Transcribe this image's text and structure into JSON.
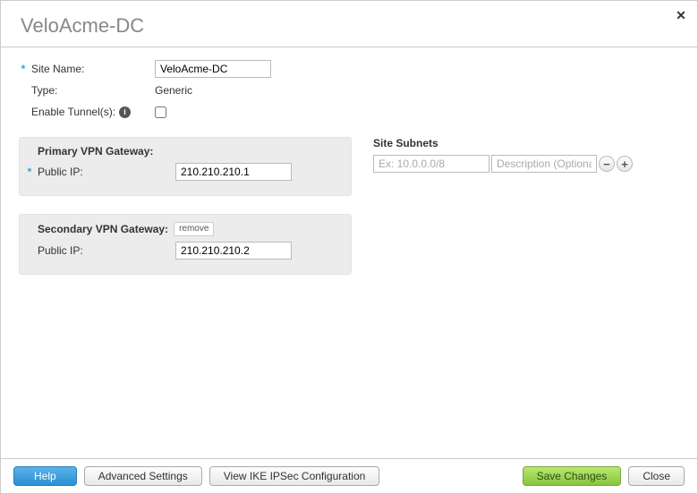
{
  "title": "VeloAcme-DC",
  "form": {
    "site_name_label": "Site Name:",
    "site_name_value": "VeloAcme-DC",
    "type_label": "Type:",
    "type_value": "Generic",
    "enable_tunnels_label": "Enable Tunnel(s):",
    "enable_tunnels_checked": false
  },
  "primary": {
    "title": "Primary VPN Gateway:",
    "public_ip_label": "Public IP:",
    "public_ip_value": "210.210.210.1"
  },
  "secondary": {
    "title": "Secondary VPN Gateway:",
    "remove_label": "remove",
    "public_ip_label": "Public IP:",
    "public_ip_value": "210.210.210.2"
  },
  "subnets": {
    "title": "Site Subnets",
    "ip_placeholder": "Ex: 10.0.0.0/8",
    "desc_placeholder": "Description (Optional)"
  },
  "footer": {
    "help": "Help",
    "advanced": "Advanced Settings",
    "view_ike": "View IKE IPSec Configuration",
    "save": "Save Changes",
    "close": "Close"
  }
}
